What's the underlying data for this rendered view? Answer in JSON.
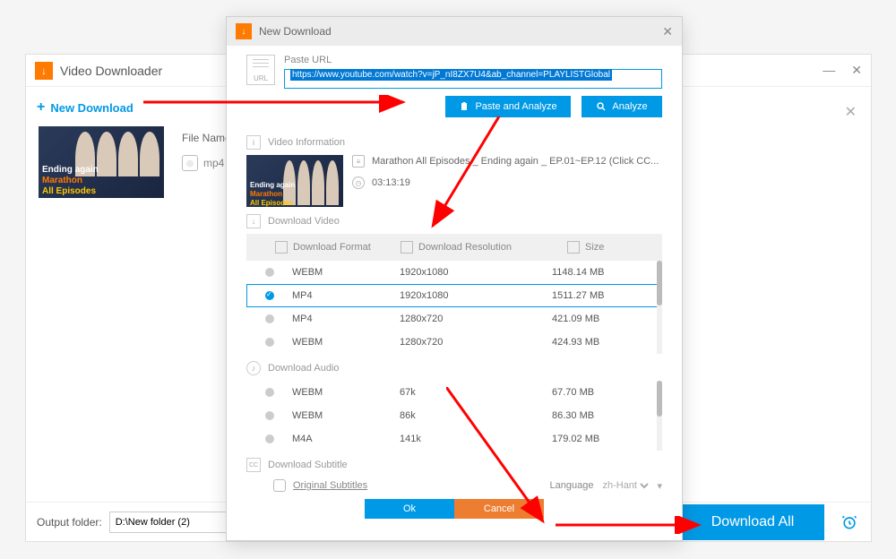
{
  "main": {
    "title": "Video Downloader",
    "new_download_btn": "New Download",
    "file_name_label": "File Name:",
    "file_type": "mp4",
    "output_label": "Output folder:",
    "output_path": "D:\\New folder (2)",
    "download_all_btn": "Download All",
    "thumb": {
      "line1": "Ending again",
      "line2": "Marathon",
      "line3": "All Episodes"
    }
  },
  "modal": {
    "title": "New Download",
    "url_label": "Paste URL",
    "url_value": "https://www.youtube.com/watch?v=jP_nI8ZX7U4&ab_channel=PLAYLISTGlobal",
    "paste_analyze_btn": "Paste and Analyze",
    "analyze_btn": "Analyze",
    "video_info_label": "Video Information",
    "video_title": "Marathon All Episodes _ Ending again _ EP.01~EP.12 (Click CC...",
    "video_duration": "03:13:19",
    "download_video_label": "Download Video",
    "table_headers": {
      "format": "Download Format",
      "resolution": "Download Resolution",
      "size": "Size"
    },
    "video_rows": [
      {
        "selected": false,
        "format": "WEBM",
        "resolution": "1920x1080",
        "size": "1148.14 MB"
      },
      {
        "selected": true,
        "format": "MP4",
        "resolution": "1920x1080",
        "size": "1511.27 MB"
      },
      {
        "selected": false,
        "format": "MP4",
        "resolution": "1280x720",
        "size": "421.09 MB"
      },
      {
        "selected": false,
        "format": "WEBM",
        "resolution": "1280x720",
        "size": "424.93 MB"
      }
    ],
    "download_audio_label": "Download Audio",
    "audio_rows": [
      {
        "selected": false,
        "format": "WEBM",
        "resolution": "67k",
        "size": "67.70 MB"
      },
      {
        "selected": false,
        "format": "WEBM",
        "resolution": "86k",
        "size": "86.30 MB"
      },
      {
        "selected": false,
        "format": "M4A",
        "resolution": "141k",
        "size": "179.02 MB"
      }
    ],
    "download_subtitle_label": "Download Subtitle",
    "original_subtitles": "Original Subtitles",
    "language_label": "Language",
    "language_value": "zh-Hant",
    "ok_btn": "Ok",
    "cancel_btn": "Cancel"
  }
}
